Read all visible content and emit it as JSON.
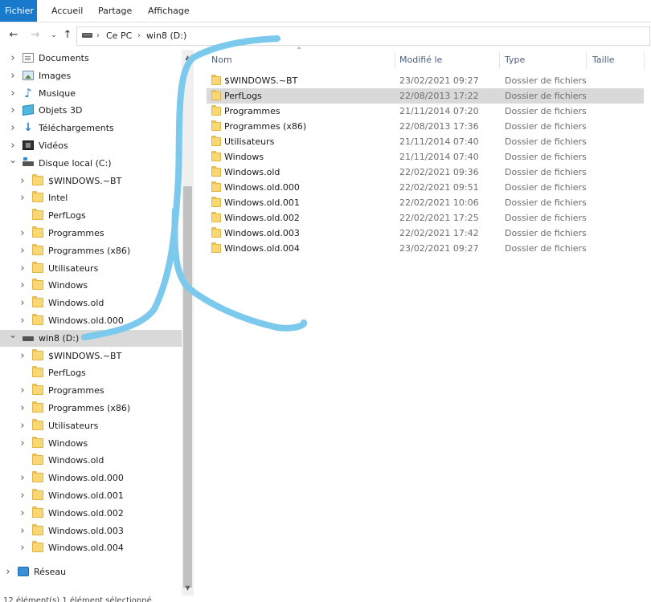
{
  "ribbon": {
    "tabs": [
      "Fichier",
      "Accueil",
      "Partage",
      "Affichage"
    ]
  },
  "address": {
    "crumbs": [
      "Ce PC",
      "win8 (D:)"
    ]
  },
  "nav": {
    "items": [
      {
        "label": "Documents",
        "icon": "documents-icon",
        "chevron": "right",
        "level": 1
      },
      {
        "label": "Images",
        "icon": "images-icon",
        "chevron": "right",
        "level": 1
      },
      {
        "label": "Musique",
        "icon": "music-icon",
        "chevron": "right",
        "level": 1
      },
      {
        "label": "Objets 3D",
        "icon": "objects-3d-icon",
        "chevron": "right",
        "level": 1
      },
      {
        "label": "Téléchargements",
        "icon": "downloads-icon",
        "chevron": "right",
        "level": 1
      },
      {
        "label": "Vidéos",
        "icon": "videos-icon",
        "chevron": "right",
        "level": 1
      },
      {
        "label": "Disque local (C:)",
        "icon": "drive-c-icon",
        "chevron": "down",
        "level": 1
      },
      {
        "label": "$WINDOWS.~BT",
        "icon": "folder-icon",
        "chevron": "right",
        "level": 2
      },
      {
        "label": "Intel",
        "icon": "folder-icon",
        "chevron": "right",
        "level": 2
      },
      {
        "label": "PerfLogs",
        "icon": "folder-icon",
        "chevron": "",
        "level": 2
      },
      {
        "label": "Programmes",
        "icon": "folder-icon",
        "chevron": "right",
        "level": 2
      },
      {
        "label": "Programmes (x86)",
        "icon": "folder-icon",
        "chevron": "right",
        "level": 2
      },
      {
        "label": "Utilisateurs",
        "icon": "folder-icon",
        "chevron": "right",
        "level": 2
      },
      {
        "label": "Windows",
        "icon": "folder-icon",
        "chevron": "right",
        "level": 2
      },
      {
        "label": "Windows.old",
        "icon": "folder-icon",
        "chevron": "right",
        "level": 2
      },
      {
        "label": "Windows.old.000",
        "icon": "folder-icon",
        "chevron": "right",
        "level": 2
      },
      {
        "label": "win8 (D:)",
        "icon": "drive-d-icon",
        "chevron": "down",
        "level": 1,
        "selected": true
      },
      {
        "label": "$WINDOWS.~BT",
        "icon": "folder-icon",
        "chevron": "right",
        "level": 2
      },
      {
        "label": "PerfLogs",
        "icon": "folder-icon",
        "chevron": "",
        "level": 2
      },
      {
        "label": "Programmes",
        "icon": "folder-icon",
        "chevron": "right",
        "level": 2
      },
      {
        "label": "Programmes (x86)",
        "icon": "folder-icon",
        "chevron": "right",
        "level": 2
      },
      {
        "label": "Utilisateurs",
        "icon": "folder-icon",
        "chevron": "right",
        "level": 2
      },
      {
        "label": "Windows",
        "icon": "folder-icon",
        "chevron": "right",
        "level": 2
      },
      {
        "label": "Windows.old",
        "icon": "folder-icon",
        "chevron": "",
        "level": 2
      },
      {
        "label": "Windows.old.000",
        "icon": "folder-icon",
        "chevron": "right",
        "level": 2
      },
      {
        "label": "Windows.old.001",
        "icon": "folder-icon",
        "chevron": "right",
        "level": 2
      },
      {
        "label": "Windows.old.002",
        "icon": "folder-icon",
        "chevron": "right",
        "level": 2
      },
      {
        "label": "Windows.old.003",
        "icon": "folder-icon",
        "chevron": "right",
        "level": 2
      },
      {
        "label": "Windows.old.004",
        "icon": "folder-icon",
        "chevron": "right",
        "level": 2
      },
      {
        "label": "Réseau",
        "icon": "network-icon",
        "chevron": "right",
        "level": 0
      }
    ]
  },
  "columns": {
    "name": "Nom",
    "modified": "Modifié le",
    "type": "Type",
    "size": "Taille"
  },
  "files": [
    {
      "name": "$WINDOWS.~BT",
      "modified": "23/02/2021 09:27",
      "type": "Dossier de fichiers"
    },
    {
      "name": "PerfLogs",
      "modified": "22/08/2013 17:22",
      "type": "Dossier de fichiers",
      "selected": true
    },
    {
      "name": "Programmes",
      "modified": "21/11/2014 07:20",
      "type": "Dossier de fichiers"
    },
    {
      "name": "Programmes (x86)",
      "modified": "22/08/2013 17:36",
      "type": "Dossier de fichiers"
    },
    {
      "name": "Utilisateurs",
      "modified": "21/11/2014 07:40",
      "type": "Dossier de fichiers"
    },
    {
      "name": "Windows",
      "modified": "21/11/2014 07:40",
      "type": "Dossier de fichiers"
    },
    {
      "name": "Windows.old",
      "modified": "22/02/2021 09:36",
      "type": "Dossier de fichiers"
    },
    {
      "name": "Windows.old.000",
      "modified": "22/02/2021 09:51",
      "type": "Dossier de fichiers"
    },
    {
      "name": "Windows.old.001",
      "modified": "22/02/2021 10:06",
      "type": "Dossier de fichiers"
    },
    {
      "name": "Windows.old.002",
      "modified": "22/02/2021 17:25",
      "type": "Dossier de fichiers"
    },
    {
      "name": "Windows.old.003",
      "modified": "22/02/2021 17:42",
      "type": "Dossier de fichiers"
    },
    {
      "name": "Windows.old.004",
      "modified": "23/02/2021 09:27",
      "type": "Dossier de fichiers"
    }
  ],
  "status": {
    "text": "12 élément(s)    1 élément sélectionné"
  },
  "colors": {
    "accent": "#1979ca",
    "selection": "#d9d9d9",
    "scribble": "#7cc9ee"
  }
}
